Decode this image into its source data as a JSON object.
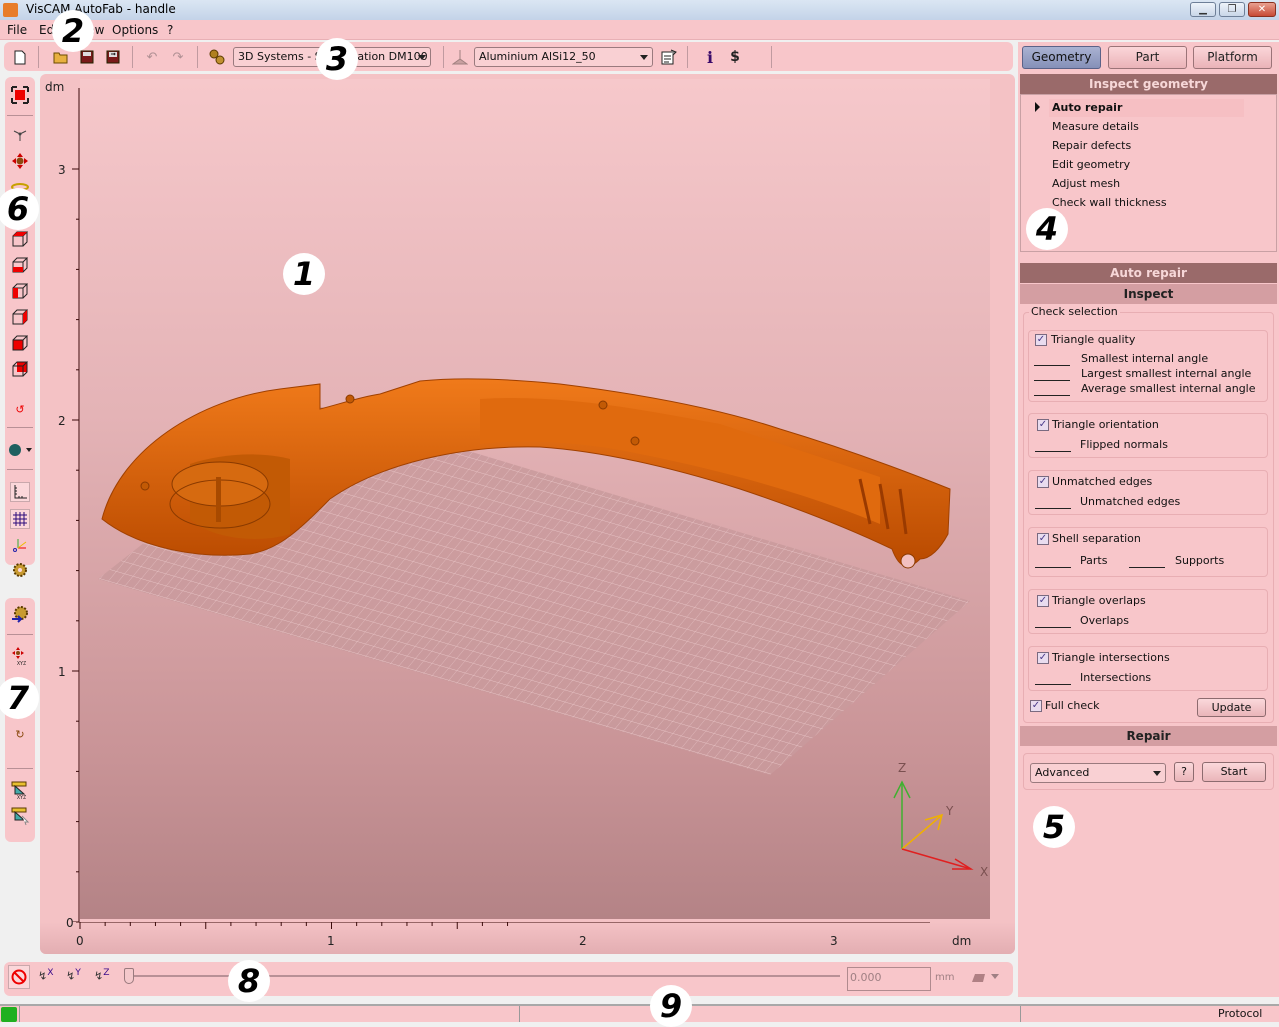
{
  "window": {
    "title": "VisCAM AutoFab - handle",
    "controls": {
      "minimize": "minimize-icon",
      "restore": "restore-icon",
      "close": "close-icon"
    }
  },
  "menu": {
    "items": [
      "File",
      "Edit",
      "View",
      "Options",
      "?"
    ]
  },
  "toolbar": {
    "icons": [
      "new-file-icon",
      "open-folder-icon",
      "save-icon",
      "save-as-icon",
      "undo-icon",
      "redo-icon",
      "machine-gears-icon",
      "material-icon",
      "material-properties-icon",
      "info-icon",
      "cost-icon"
    ],
    "machine_select": "3D Systems - Sinterstation DM100",
    "material_select": "Aluminium AlSi12_50"
  },
  "left_tools_upper": {
    "icons": [
      "fit-view-icon",
      "rotate-view-icon",
      "pan-view-icon",
      "zoom-view-icon",
      "view-rotate-reset-icon",
      "view-top-icon",
      "view-front-icon",
      "view-left-icon",
      "view-right-icon",
      "view-back-icon",
      "view-bottom-icon",
      "undo-view-icon",
      "shading-sphere-icon",
      "ruler-axes-icon",
      "grid-icon",
      "coordinate-axes-icon",
      "settings-gear-icon"
    ]
  },
  "left_tools_lower": {
    "icons": [
      "import-gear-icon",
      "move-xyz-icon",
      "move-mouse-icon",
      "rotate-xyz-icon",
      "rotate-mouse-icon",
      "scale-xyz-icon",
      "scale-mouse-icon"
    ]
  },
  "viewport": {
    "unit_y": "dm",
    "unit_x": "dm",
    "y_ticks": [
      "3",
      "2",
      "1",
      "0"
    ],
    "x_ticks": [
      "0",
      "1",
      "2",
      "3"
    ],
    "axes": {
      "z": "Z",
      "y": "Y",
      "x": "X"
    },
    "colors": {
      "model": "#e0620a",
      "x_axis": "#e02020",
      "y_axis": "#f0b000",
      "z_axis": "#40b030"
    }
  },
  "right_panel": {
    "tabs": [
      {
        "label": "Geometry",
        "active": true
      },
      {
        "label": "Part",
        "active": false
      },
      {
        "label": "Platform",
        "active": false
      }
    ],
    "inspect_header": "Inspect geometry",
    "nav_items": [
      {
        "label": "Auto repair",
        "selected": true
      },
      {
        "label": "Measure details",
        "selected": false
      },
      {
        "label": "Repair defects",
        "selected": false
      },
      {
        "label": "Edit geometry",
        "selected": false
      },
      {
        "label": "Adjust mesh",
        "selected": false
      },
      {
        "label": "Check wall thickness",
        "selected": false
      }
    ],
    "auto_repair_header": "Auto repair",
    "inspect_subheader": "Inspect",
    "check_selection_label": "Check selection",
    "checks": {
      "triangle_quality": {
        "label": "Triangle quality",
        "checked": true,
        "results": [
          "Smallest internal angle",
          "Largest smallest internal angle",
          "Average smallest internal angle"
        ]
      },
      "triangle_orientation": {
        "label": "Triangle orientation",
        "checked": true,
        "results": [
          "Flipped normals"
        ]
      },
      "unmatched_edges": {
        "label": "Unmatched edges",
        "checked": true,
        "results": [
          "Unmatched edges"
        ]
      },
      "shell_separation": {
        "label": "Shell separation",
        "checked": true,
        "results": [
          "Parts",
          "Supports"
        ]
      },
      "triangle_overlaps": {
        "label": "Triangle overlaps",
        "checked": true,
        "results": [
          "Overlaps"
        ]
      },
      "triangle_intersections": {
        "label": "Triangle intersections",
        "checked": true,
        "results": [
          "Intersections"
        ]
      }
    },
    "full_check": {
      "label": "Full check",
      "checked": true
    },
    "update_button": "Update",
    "repair_subheader": "Repair",
    "repair_mode": "Advanced",
    "help_button": "?",
    "start_button": "Start"
  },
  "bottom_bar": {
    "icons": [
      "no-section-icon",
      "section-x-icon",
      "section-y-icon",
      "section-z-icon"
    ],
    "axis_labels": [
      "X",
      "Y",
      "Z"
    ],
    "slider_value": 0,
    "value_input": "0.000",
    "unit": "mm"
  },
  "status_bar": {
    "protocol_label": "Protocol",
    "status_color": "#20b020"
  },
  "callouts": [
    "1",
    "2",
    "3",
    "4",
    "5",
    "6",
    "7",
    "8",
    "9"
  ]
}
